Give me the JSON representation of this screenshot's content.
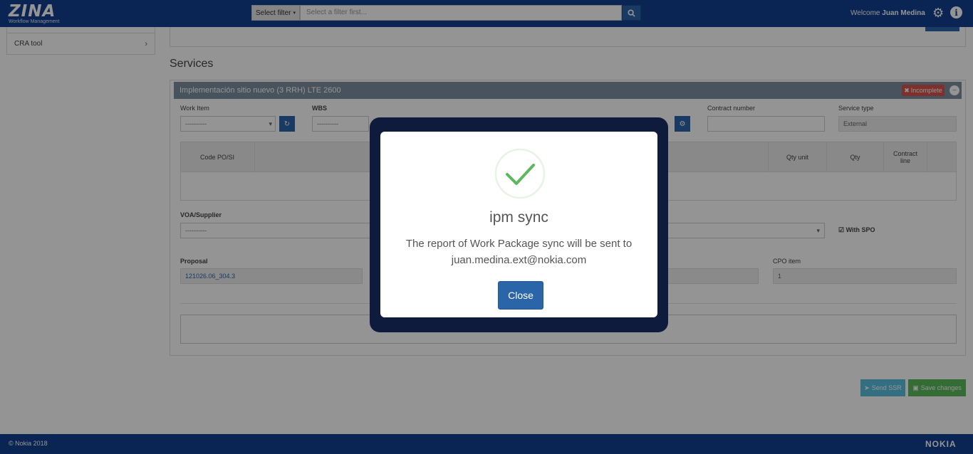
{
  "header": {
    "logo": "ZINA",
    "logo_subtitle": "Workflow Management",
    "filter_label": "Select filter",
    "filter_placeholder": "Select a filter first...",
    "welcome_prefix": "Welcome",
    "user_name": "Juan Medina"
  },
  "sidebar": {
    "items": [
      {
        "label": "CRA tool"
      }
    ]
  },
  "main": {
    "section_title": "Services",
    "service": {
      "title": "Implementación sitio nuevo (3 RRH) LTE 2600",
      "status_badge": "Incomplete",
      "work_item_label": "Work Item",
      "work_item_value": "----------",
      "wbs_label": "WBS",
      "wbs_value": "----------",
      "contract_number_label": "Contract number",
      "service_type_label": "Service type",
      "service_type_value": "External",
      "table_headers": [
        "Code PO/SI",
        "Qty unit",
        "Qty",
        "Contract line"
      ],
      "supplier_label": "VOA/Supplier",
      "supplier_value": "----------",
      "with_spo_label": "With SPO",
      "proposal_label": "Proposal",
      "proposal_value": "121026.06_304.3",
      "cpo_item_label": "CPO item",
      "cpo_item_value": "1"
    },
    "actions": {
      "send_ssr": "Send SSR",
      "save_changes": "Save changes"
    }
  },
  "footer": {
    "copyright": "© Nokia 2018",
    "brand": "NOKIA"
  },
  "modal": {
    "title": "ipm sync",
    "message_line1": "The report of Work Package sync will be sent to",
    "message_line2": "juan.medina.ext@nokia.com",
    "close_label": "Close"
  },
  "colors": {
    "brand": "#124191",
    "primary_button": "#2b65a9",
    "success_check": "#5cb85c",
    "danger": "#d9534f"
  }
}
